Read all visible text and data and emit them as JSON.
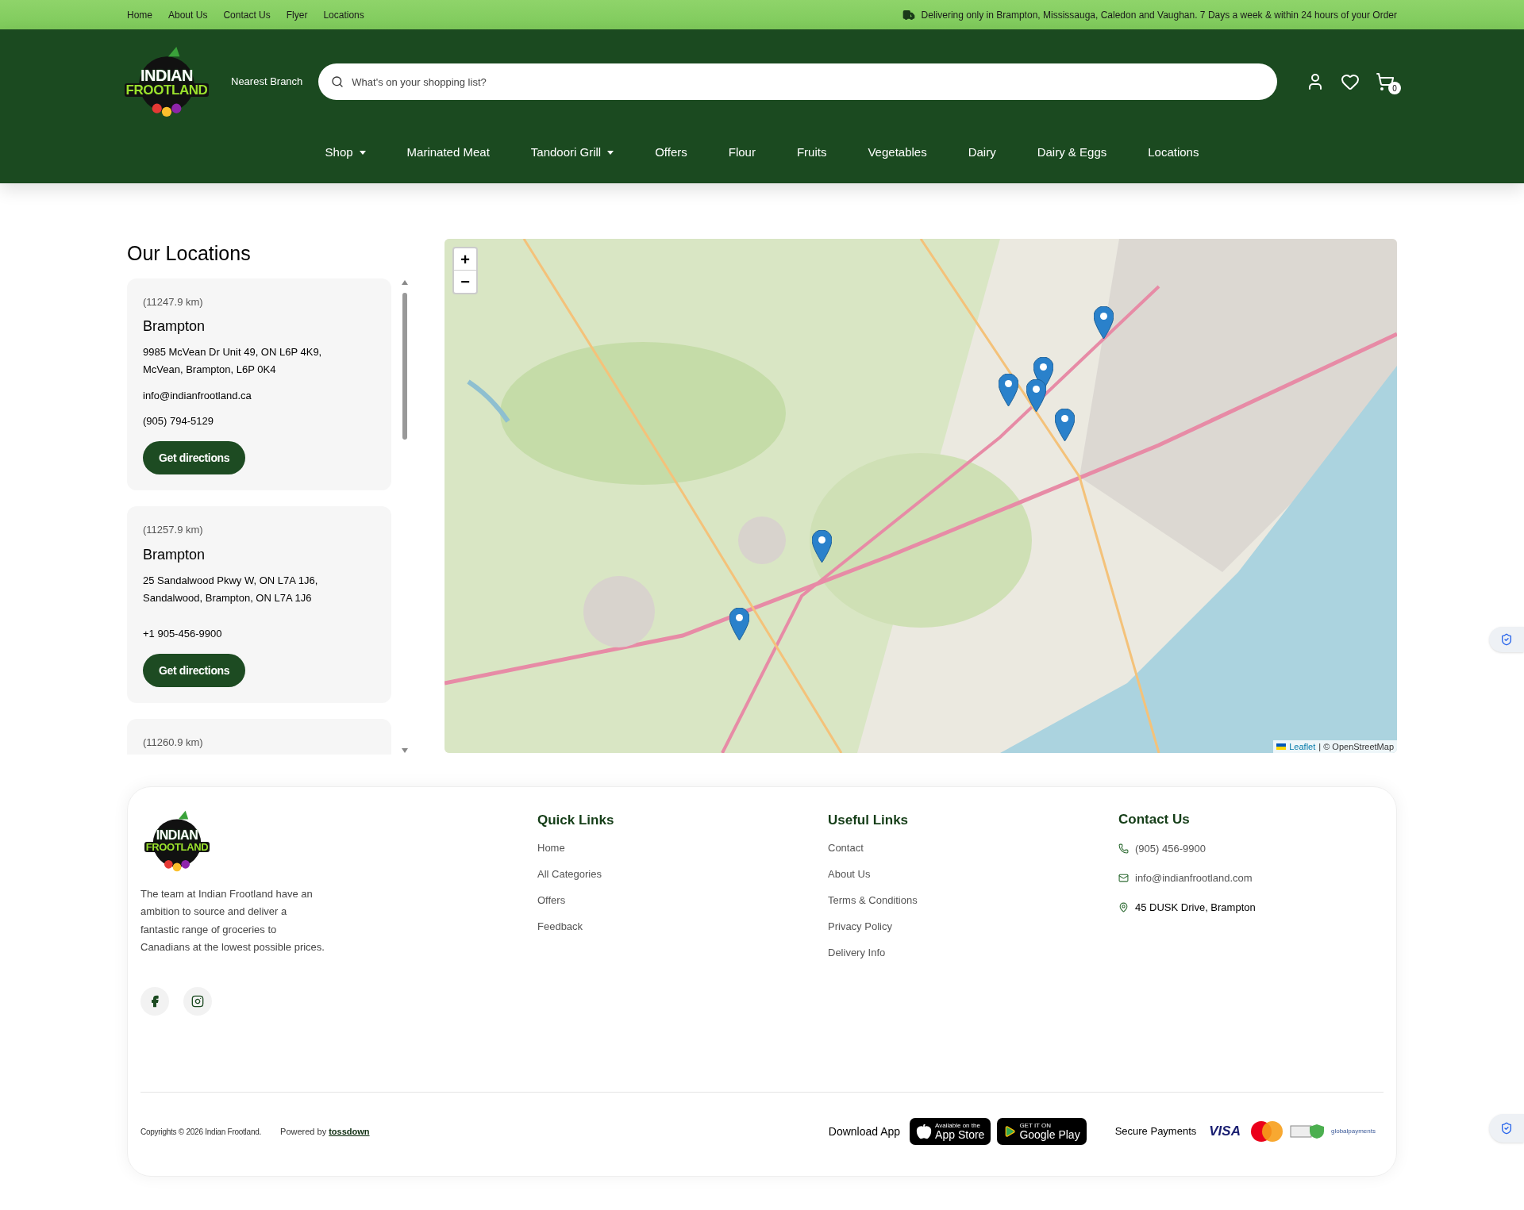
{
  "top_bar": {
    "links": [
      "Home",
      "About Us",
      "Contact Us",
      "Flyer",
      "Locations"
    ],
    "notice": "Delivering only in Brampton, Mississauga, Caledon and Vaughan. 7 Days a week & within 24 hours of your Order"
  },
  "header": {
    "logo": {
      "line1": "INDIAN",
      "line2": "FROOTLAND"
    },
    "branch": "Nearest Branch",
    "search": {
      "placeholder": "What's on your shopping list?"
    },
    "cart_count": "0"
  },
  "nav": [
    {
      "label": "Shop",
      "dropdown": true
    },
    {
      "label": "Marinated Meat",
      "dropdown": false
    },
    {
      "label": "Tandoori Grill",
      "dropdown": true
    },
    {
      "label": "Offers",
      "dropdown": false
    },
    {
      "label": "Flour",
      "dropdown": false
    },
    {
      "label": "Fruits",
      "dropdown": false
    },
    {
      "label": "Vegetables",
      "dropdown": false
    },
    {
      "label": "Dairy",
      "dropdown": false
    },
    {
      "label": "Dairy & Eggs",
      "dropdown": false
    },
    {
      "label": "Locations",
      "dropdown": false
    }
  ],
  "locations": {
    "title": "Our Locations",
    "items": [
      {
        "distance": "(11247.9 km)",
        "name": "Brampton",
        "address": "9985 McVean Dr Unit 49, ON L6P 4K9, McVean, Brampton, L6P 0K4",
        "email": "info@indianfrootland.ca",
        "phone": "(905) 794-5129",
        "button": "Get directions"
      },
      {
        "distance": "(11257.9 km)",
        "name": "Brampton",
        "address": "25 Sandalwood Pkwy W, ON L7A 1J6, Sandalwood, Brampton, ON L7A 1J6",
        "phone": "+1 905-456-9900",
        "button": "Get directions"
      },
      {
        "distance": "(11260.9 km)"
      }
    ]
  },
  "map": {
    "zoom_in": "+",
    "zoom_out": "−",
    "attribution_link": "Leaflet",
    "attribution_text": "| © OpenStreetMap"
  },
  "footer": {
    "logo": {
      "line1": "INDIAN",
      "line2": "FROOTLAND"
    },
    "about": "The team at Indian Frootland have an ambition to source and deliver a fantastic range of groceries to Canadians at the lowest possible prices.",
    "columns": [
      {
        "title": "Quick Links",
        "links": [
          "Home",
          "All Categories",
          "Offers",
          "Feedback"
        ]
      },
      {
        "title": "Useful Links",
        "links": [
          "Contact",
          "About Us",
          "Terms & Conditions",
          "Privacy Policy",
          "Delivery Info"
        ]
      }
    ],
    "contact": {
      "title": "Contact Us",
      "items": [
        {
          "kind": "phone",
          "text": "(905) 456-9900"
        },
        {
          "kind": "email",
          "text": "info@indianfrootland.com"
        },
        {
          "kind": "location",
          "text": "45 DUSK Drive, Brampton"
        }
      ]
    },
    "copyright": "Copyrights © 2026 Indian Frootland.",
    "powered_label": "Powered by",
    "powered_link": "tossdown",
    "download_label": "Download App",
    "app_store": {
      "small": "Available on the",
      "big": "App Store"
    },
    "google_play": {
      "small": "GET IT ON",
      "big": "Google Play"
    },
    "payments_label": "Secure Payments",
    "visa": "VISA",
    "global": "globalpayments"
  }
}
